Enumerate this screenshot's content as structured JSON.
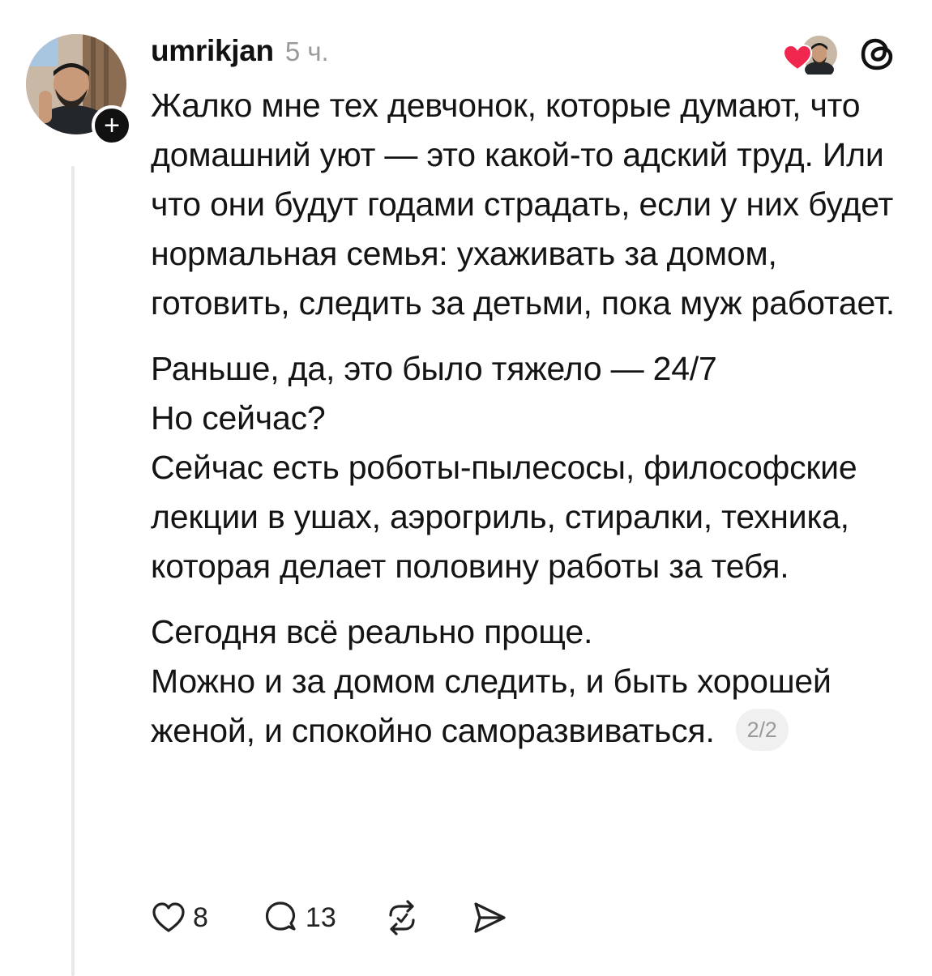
{
  "post": {
    "username": "umrikjan",
    "time": "5 ч.",
    "follow_symbol": "+",
    "paragraphs": [
      "Жалко мне тех девчонок, которые думают, что домашний уют — это какой-то адский труд. Или что они будут годами страдать, если у них будет нормальная семья: ухаживать за домом, готовить, следить за детьми, пока муж работает.",
      "Раньше, да, это было тяжело — 24/7",
      "Но сейчас?",
      "Сейчас есть роботы-пылесосы, философские лекции в ушах, аэрогриль, стиралки, техника, которая делает половину работы за тебя.",
      "Сегодня всё реально проще.",
      "Можно и за домом следить, и быть хорошей женой, и спокойно саморазвиваться."
    ],
    "page_indicator": "2/2"
  },
  "actions": {
    "like_count": "8",
    "comment_count": "13"
  },
  "icons": {
    "like": "heart-icon",
    "comment": "comment-bubble-icon",
    "repost": "repost-icon",
    "share": "send-icon",
    "threads": "threads-logo-icon",
    "liked_by": "liked-by-avatar-heart-icon"
  },
  "colors": {
    "text": "#141414",
    "muted": "#9a9a9a",
    "heart_red": "#f0274f",
    "thread_line": "#e8e8e8"
  }
}
